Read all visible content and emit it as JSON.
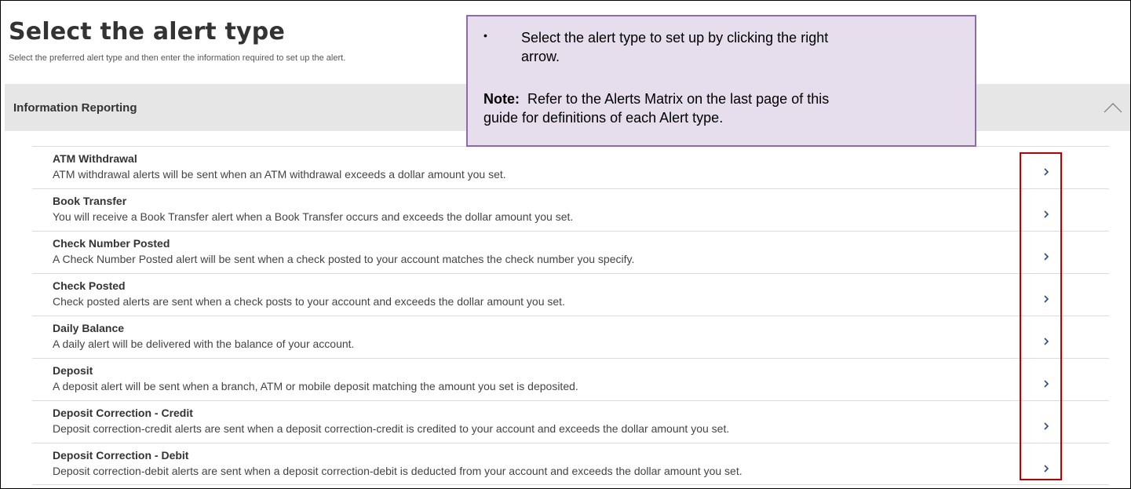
{
  "page": {
    "title": "Select the alert type",
    "subtitle": "Select the preferred alert type and then enter the information required to set up the alert."
  },
  "section": {
    "title": "Information Reporting",
    "collapse_icon": "chevron-up-icon"
  },
  "alerts": [
    {
      "title": "ATM Withdrawal",
      "description": "ATM withdrawal alerts will be sent when an ATM withdrawal exceeds a dollar amount you set."
    },
    {
      "title": "Book Transfer",
      "description": "You will receive a Book Transfer alert when a Book Transfer occurs and exceeds the dollar amount you set."
    },
    {
      "title": "Check Number Posted",
      "description": "A Check Number Posted alert will be sent when a check posted to your account matches the check number you specify."
    },
    {
      "title": "Check Posted",
      "description": "Check posted alerts are sent when a check posts to your account and exceeds the dollar amount you set."
    },
    {
      "title": "Daily Balance",
      "description": "A daily alert will be delivered with the balance of your account."
    },
    {
      "title": "Deposit",
      "description": "A deposit alert will be sent when a branch, ATM or mobile deposit matching the amount you set is deposited."
    },
    {
      "title": "Deposit Correction - Credit",
      "description": "Deposit correction-credit alerts are sent when a deposit correction-credit is credited to your account and exceeds the dollar amount you set."
    },
    {
      "title": "Deposit Correction - Debit",
      "description": "Deposit correction-debit alerts are sent when a deposit correction-debit is deducted from your account and exceeds the dollar amount you set."
    }
  ],
  "callout": {
    "bullet": "•",
    "line1": "Select the alert type to set up by clicking the right",
    "line2": "arrow.",
    "note_label": "Note:",
    "note_line1": "Refer to the Alerts Matrix on the last page of this",
    "note_line2": "guide for definitions of each Alert type."
  },
  "colors": {
    "chevron": "#2b4a8b",
    "highlight": "#c00000",
    "callout_bg": "#e6deec",
    "callout_border": "#8f6aa8",
    "section_bg": "#e6e6e6"
  }
}
